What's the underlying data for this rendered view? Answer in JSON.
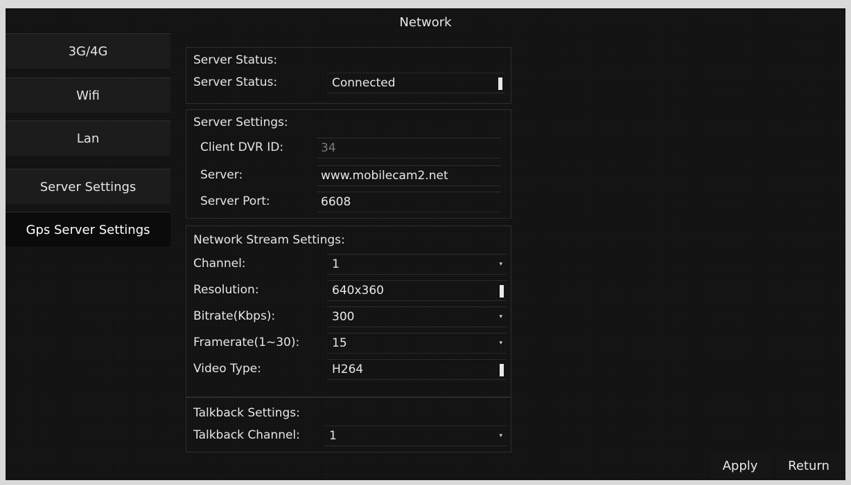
{
  "window": {
    "title": "Network"
  },
  "sidebar": {
    "items": [
      {
        "label": "3G/4G"
      },
      {
        "label": "Wifi"
      },
      {
        "label": "Lan"
      },
      {
        "label": "Server Settings"
      },
      {
        "label": "Gps Server Settings"
      }
    ],
    "active": "Gps Server Settings"
  },
  "server_status": {
    "group_label": "Server Status:",
    "label": "Server Status:",
    "value": "Connected"
  },
  "server_settings": {
    "group_label": "Server Settings:",
    "client_id_label": "Client DVR ID:",
    "client_id_value": "34",
    "server_label": "Server:",
    "server_value": "www.mobilecam2.net",
    "port_label": "Server Port:",
    "port_value": "6608"
  },
  "stream_settings": {
    "group_label": "Network Stream Settings:",
    "channel_label": "Channel:",
    "channel_value": "1",
    "resolution_label": "Resolution:",
    "resolution_value": "640x360",
    "bitrate_label": "Bitrate(Kbps):",
    "bitrate_value": "300",
    "framerate_label": "Framerate(1~30):",
    "framerate_value": "15",
    "video_type_label": "Video Type:",
    "video_type_value": "H264"
  },
  "talkback": {
    "group_label": "Talkback Settings:",
    "channel_label": "Talkback Channel:",
    "channel_value": "1"
  },
  "buttons": {
    "apply": "Apply",
    "return": "Return"
  }
}
